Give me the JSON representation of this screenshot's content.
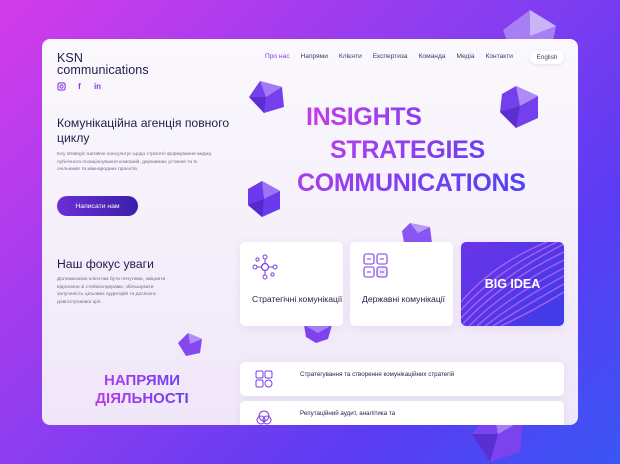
{
  "logo": {
    "line1": "KSN",
    "line2": "communications"
  },
  "socials": [
    {
      "name": "instagram-icon",
      "glyph": "◘"
    },
    {
      "name": "facebook-icon",
      "glyph": "f"
    },
    {
      "name": "linkedin-icon",
      "glyph": "in"
    }
  ],
  "nav": {
    "items": [
      "Про нас",
      "Напрями",
      "Клієнти",
      "Експертиза",
      "Команда",
      "Медіа",
      "Контакти"
    ],
    "active_index": 0,
    "language": "English"
  },
  "hero": {
    "title": "Комунікаційна агенція повного циклу",
    "description": "Key strategic narrative консультує щодо стратегії формування іміджу, публічного позиціонування компаній, державних установ та їх очільників та міжнародних проєктів.",
    "cta": "Написати нам",
    "words": [
      "INSIGHTS",
      "STRATEGIES",
      "COMMUNICATIONS"
    ]
  },
  "focus": {
    "title": "Наш фокус уваги",
    "description": "Допомагаємо клієнтам бути почутими, зміцнити відносини зі стейкхолдерами, збільшувати залученість цільових аудиторій та досягати довгострокової цілі."
  },
  "tiles": [
    {
      "label": "Стратегічні комунікації",
      "icon": "network-icon"
    },
    {
      "label": "Державні комунікації",
      "icon": "documents-icon"
    },
    {
      "label": "BIG IDEA",
      "icon": ""
    }
  ],
  "directions": {
    "title": "НАПРЯМИ ДІЯЛЬНОСТІ",
    "rows": [
      {
        "text": "Стратегування та створення комунікаційних стратегій",
        "icon": "strategy-icon"
      },
      {
        "text": "Репутаційний аудит, аналітика та",
        "icon": "audit-icon"
      }
    ]
  },
  "colors": {
    "accent": "#7b3be6",
    "dark": "#1d1e4b",
    "gradient_start": "#d43bea",
    "gradient_end": "#3a56f5"
  }
}
